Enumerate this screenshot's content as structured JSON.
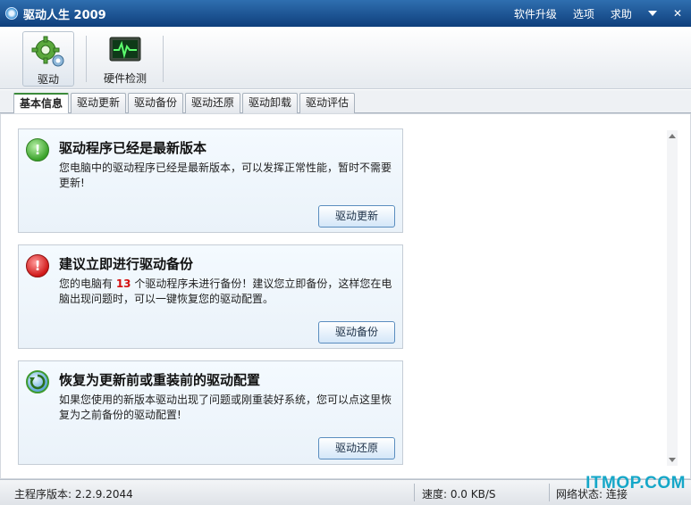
{
  "window": {
    "title": "驱动人生 2009"
  },
  "title_menu": {
    "upgrade": "软件升级",
    "options": "选项",
    "help": "求助",
    "close_glyph": "✕"
  },
  "toolbar": {
    "driver_label": "驱动",
    "hardware_label": "硬件检测"
  },
  "tabs": [
    {
      "label": "基本信息"
    },
    {
      "label": "驱动更新"
    },
    {
      "label": "驱动备份"
    },
    {
      "label": "驱动还原"
    },
    {
      "label": "驱动卸载"
    },
    {
      "label": "驱动评估"
    }
  ],
  "cards": [
    {
      "title": "驱动程序已经是最新版本",
      "desc": "您电脑中的驱动程序已经是最新版本，可以发挥正常性能，暂时不需要更新!",
      "button": "驱动更新",
      "icon_glyph": "!"
    },
    {
      "title": "建议立即进行驱动备份",
      "desc_before": "您的电脑有 ",
      "count": "13",
      "desc_after": " 个驱动程序未进行备份！建议您立即备份，这样您在电脑出现问题时，可以一键恢复您的驱动配置。",
      "button": "驱动备份",
      "icon_glyph": "!"
    },
    {
      "title": "恢复为更新前或重装前的驱动配置",
      "desc": "如果您使用的新版本驱动出现了问题或刚重装好系统，您可以点这里恢复为之前备份的驱动配置!",
      "button": "驱动还原"
    }
  ],
  "status": {
    "version": "主程序版本: 2.2.9.2044",
    "speed": "速度: 0.0 KB/S",
    "network": "网络状态: 连接"
  },
  "watermark": "ITMOP.COM",
  "colors": {
    "accent_green": "#3b8a3b",
    "count_red": "#d41010"
  }
}
